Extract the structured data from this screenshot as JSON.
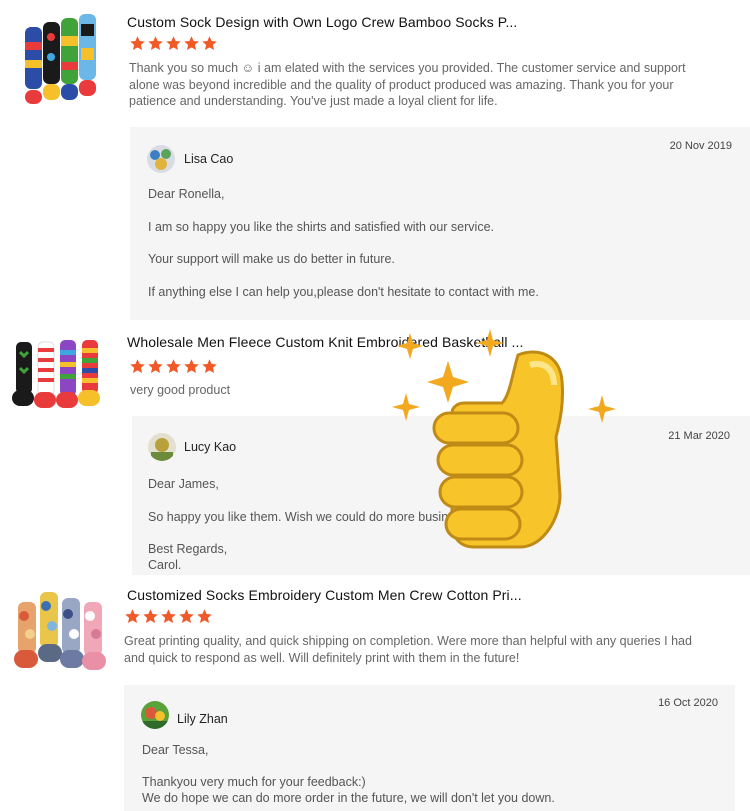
{
  "colors": {
    "star": "#f05a28",
    "reply_bg": "#f5f5f5",
    "title": "#111111",
    "text": "#666666",
    "thumb_yellow": "#f7c52a",
    "sparkle": "#f2a91f"
  },
  "reviews": [
    {
      "product_title": "Custom Sock Design with Own Logo Crew Bamboo Socks P...",
      "rating": 5,
      "text": "Thank you so much ☺ i am elated with the services you provided. The customer service and support alone was beyond incredible and the quality of product produced was amazing. Thank you for your patience and understanding. You've just made a loyal client for life.",
      "reply": {
        "name": "Lisa Cao",
        "date": "20 Nov 2019",
        "lines": [
          "Dear Ronella,",
          "I am so happy you like the shirts and satisfied with our service.",
          "Your support will make us do better in future.",
          "If anything else I can help you,please don't hesitate to contact with me."
        ]
      }
    },
    {
      "product_title": "Wholesale Men Fleece Custom Knit Embroidered Basketball ...",
      "rating": 5,
      "text": "very good product",
      "reply": {
        "name": "Lucy Kao",
        "date": "21 Mar 2020",
        "lines": [
          "Dear James,",
          "So happy you like them. Wish we could do more business.",
          "Best Regards,",
          "Carol."
        ]
      }
    },
    {
      "product_title": "Customized Socks Embroidery Custom Men Crew Cotton Pri...",
      "rating": 5,
      "text": "Great printing quality, and quick shipping on completion. Were more than helpful with any queries I had and quick to respond as well. Will definitely print with them in the future!",
      "reply": {
        "name": "Lily Zhan",
        "date": "16 Oct 2020",
        "lines": [
          "Dear Tessa,",
          "Thankyou very much for your feedback:)",
          "We do hope we can do more order in the future, we will don't let you down."
        ]
      }
    }
  ],
  "icons": {
    "rating": "star-icon",
    "sticker": "thumbs-up-icon",
    "decor": "sparkle-icon"
  }
}
